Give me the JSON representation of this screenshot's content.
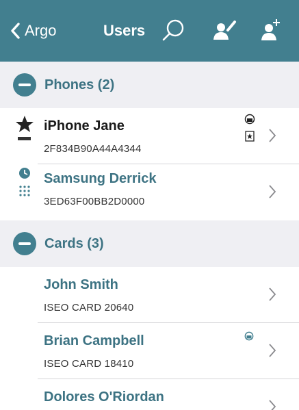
{
  "navbar": {
    "back_label": "Argo",
    "title": "Users"
  },
  "sections": [
    {
      "title": "Phones (2)"
    },
    {
      "title": "Cards (3)"
    }
  ],
  "phones": [
    {
      "name": "iPhone Jane",
      "id": "2F834B90A44A4344",
      "leading_icon": "star-icon",
      "badge": "login-badge",
      "status_icons": [
        "lock-icon",
        "star-card-icon"
      ]
    },
    {
      "name": "Samsung Derrick",
      "id": "3ED63F00BB2D0000",
      "leading_icon": "clock-icon",
      "badge": "login-keypad-icon",
      "status_icons": []
    }
  ],
  "cards": [
    {
      "name": "John Smith",
      "id": "ISEO CARD 20640",
      "status_icons": []
    },
    {
      "name": "Brian Campbell",
      "id": "ISEO CARD 18410",
      "status_icons": [
        "lock-icon"
      ]
    },
    {
      "name": "Dolores O'Riordan",
      "id": "",
      "status_icons": []
    }
  ],
  "colors": {
    "accent": "#427f8f",
    "name_text": "#3d7383",
    "section_bg": "#efeff3",
    "divider": "#d5d5d8"
  },
  "icons": {
    "back": "chevron-left-icon",
    "search": "search-icon",
    "edit_user": "user-edit-icon",
    "add_user": "user-add-icon",
    "row_disclosure": "chevron-right-icon"
  }
}
